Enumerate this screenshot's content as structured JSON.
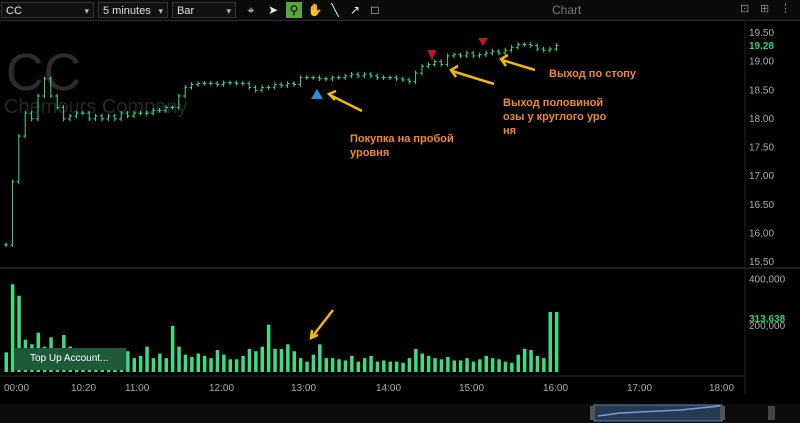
{
  "toolbar": {
    "symbol": "CC",
    "interval": "5 minutes",
    "chart_style": "Bar",
    "window_title": "Chart",
    "tools": [
      "crosshair-icon",
      "pointer-icon",
      "zoom-icon",
      "hand-icon",
      "line-icon",
      "arrow-icon",
      "rectangle-icon"
    ]
  },
  "watermark": {
    "symbol": "CC",
    "company": "Chemours Company"
  },
  "colors": {
    "bar": "#3ddc84",
    "annotation_text": "#f08a2d",
    "arrow": "#f5b800",
    "buy_marker": "#2b8fd6",
    "sell_marker": "#c01818",
    "last_price": "#28d07a"
  },
  "annotations": {
    "buy": "Покупка на пробой уровня",
    "exit_half": "Выход половиной позы у круглого уровня",
    "exit_stop": "Выход по стопу"
  },
  "topup_label": "Top Up Account...",
  "chart_data": [
    {
      "type": "ohlc",
      "title": "",
      "price_axis": {
        "ylim": [
          15.5,
          19.6
        ],
        "ticks": [
          "19.50",
          "19.00",
          "18.50",
          "18.00",
          "17.50",
          "17.00",
          "16.50",
          "16.00",
          "15.50"
        ],
        "last": "19.28"
      },
      "time_axis": {
        "ticks": [
          "00:00",
          "10:20",
          "11:00",
          "12:00",
          "13:00",
          "14:00",
          "15:00",
          "16:00",
          "17:00",
          "18:00"
        ]
      },
      "closes": [
        15.8,
        16.9,
        17.7,
        18.1,
        18.0,
        18.4,
        18.7,
        18.4,
        18.2,
        18.0,
        18.05,
        18.1,
        18.1,
        18.0,
        18.05,
        18.0,
        18.05,
        18.0,
        18.1,
        18.05,
        18.1,
        18.1,
        18.1,
        18.15,
        18.15,
        18.2,
        18.2,
        18.4,
        18.55,
        18.6,
        18.62,
        18.62,
        18.62,
        18.6,
        18.63,
        18.63,
        18.62,
        18.62,
        18.55,
        18.5,
        18.55,
        18.55,
        18.6,
        18.58,
        18.62,
        18.6,
        18.72,
        18.72,
        18.72,
        18.7,
        18.7,
        18.72,
        18.72,
        18.75,
        18.78,
        18.75,
        18.78,
        18.75,
        18.72,
        18.72,
        18.72,
        18.7,
        18.68,
        18.65,
        18.8,
        18.92,
        18.95,
        19.0,
        18.95,
        19.1,
        19.12,
        19.1,
        19.15,
        19.1,
        19.12,
        19.15,
        19.18,
        19.15,
        19.2,
        19.25,
        19.3,
        19.3,
        19.28,
        19.22,
        19.2,
        19.22,
        19.28
      ],
      "volume": {
        "ticks": [
          "400,000",
          "200,000"
        ],
        "last": "313,638",
        "values": [
          85,
          380,
          330,
          140,
          120,
          170,
          110,
          150,
          80,
          160,
          110,
          90,
          70,
          90,
          60,
          70,
          80,
          60,
          70,
          90,
          60,
          70,
          110,
          60,
          80,
          60,
          200,
          110,
          75,
          65,
          80,
          70,
          60,
          95,
          75,
          55,
          55,
          70,
          100,
          90,
          110,
          205,
          100,
          100,
          120,
          90,
          60,
          45,
          75,
          120,
          60,
          60,
          55,
          50,
          70,
          45,
          60,
          70,
          45,
          50,
          45,
          45,
          40,
          60,
          100,
          80,
          70,
          60,
          55,
          65,
          50,
          50,
          60,
          45,
          55,
          70,
          60,
          55,
          45,
          40,
          75,
          100,
          95,
          70,
          60,
          260,
          260
        ]
      }
    }
  ]
}
